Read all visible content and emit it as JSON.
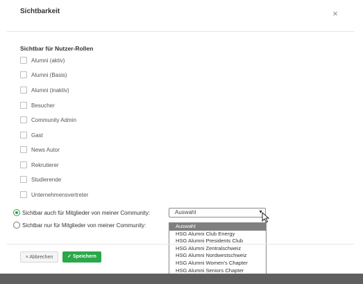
{
  "modal": {
    "title": "Sichtbarkeit",
    "close_glyph": "×",
    "section_label": "Sichtbar für Nutzer-Rollen",
    "roles": [
      "Alumni (aktiv)",
      "Alumni (Basis)",
      "Alumni (inaktiv)",
      "Besucher",
      "Community Admin",
      "Gast",
      "News Autor",
      "Rekrutierer",
      "Studierende",
      "Unternehmensvertreter"
    ],
    "radio_visible_also": "Sichtbar auch für Mitglieder von meiner Community:",
    "radio_visible_only": "Sichtbar nur für Mitglieder von meiner Community:",
    "select_value": "Auswahl",
    "dropdown_options": [
      "Auswahl",
      "HSG Alumni Club Energy",
      "HSG Alumni Presidents Club",
      "HSG Alumni Zentralschweiz",
      "HSG Alumni Nordwestschweiz",
      "HSG Alumni Women's Chapter",
      "HSG Alumni Seniors Chapter"
    ],
    "cancel_label": "× Abbrechen",
    "save_label": "✓ Speichern"
  },
  "colors": {
    "accent": "#2aa84a",
    "selected_option": "#7f7f7f"
  },
  "icons": {
    "close": "close-icon",
    "chevron": "chevron-down-icon",
    "cursor": "mouse-pointer-icon"
  }
}
